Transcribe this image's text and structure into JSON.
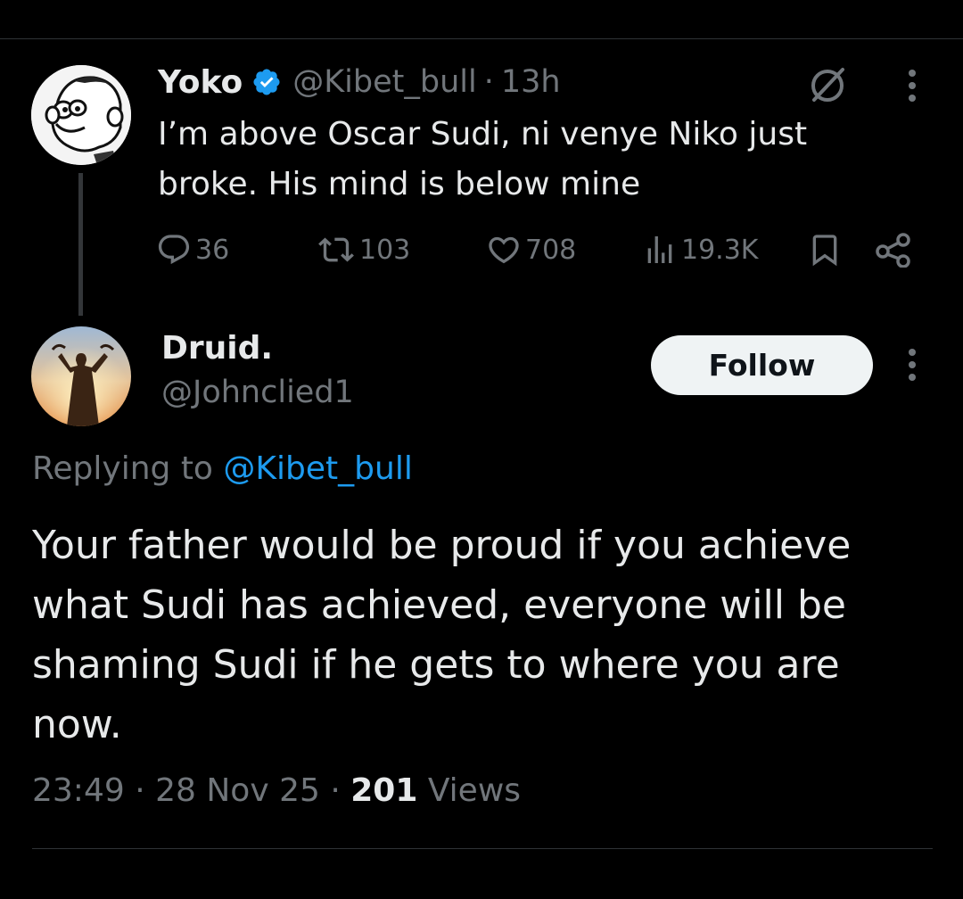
{
  "parent_tweet": {
    "display_name": "Yoko",
    "handle": "@Kibet_bull",
    "separator": "·",
    "time": "13h",
    "text": "I’m above Oscar Sudi, ni venye Niko just broke. His mind is below mine",
    "actions": {
      "replies": "36",
      "reposts": "103",
      "likes": "708",
      "views": "19.3K"
    },
    "icons": [
      "verified-badge-icon",
      "grok-icon",
      "more-icon",
      "reply-icon",
      "repost-icon",
      "like-icon",
      "views-icon",
      "bookmark-icon",
      "share-icon"
    ]
  },
  "reply_tweet": {
    "display_name": "Druid.",
    "handle": "@Johnclied1",
    "follow_label": "Follow",
    "replying_prefix": "Replying to",
    "replying_mention": "@Kibet_bull",
    "text": "Your father would be proud if you achieve what Sudi has achieved, everyone will be shaming Sudi if he gets to where you are now.",
    "time": "23:49",
    "separator": "·",
    "date": "28 Nov 25",
    "views_count": "201",
    "views_label": "Views"
  },
  "colors": {
    "background": "#000000",
    "text_primary": "#e7e9ea",
    "text_secondary": "#71767b",
    "link": "#1d9bf0",
    "verified": "#1d9bf0",
    "divider": "#2f3336"
  }
}
